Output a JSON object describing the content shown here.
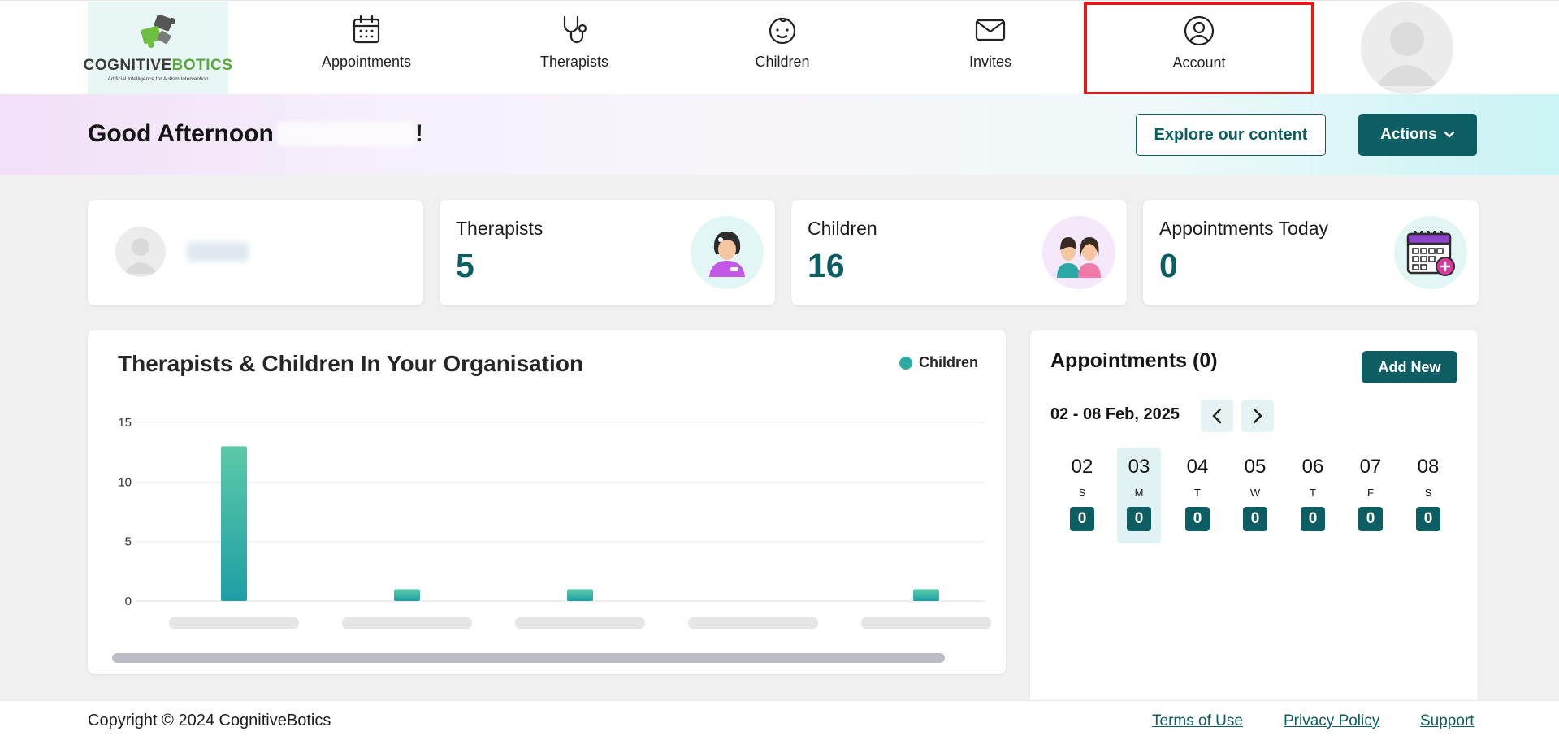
{
  "brand": {
    "name_a": "COGNITIVE",
    "name_b": "BOTICS",
    "tagline": "Artificial Intelligence for Autism Intervention"
  },
  "nav": {
    "items": [
      {
        "label": "Appointments",
        "icon": "calendar-icon"
      },
      {
        "label": "Therapists",
        "icon": "stethoscope-icon"
      },
      {
        "label": "Children",
        "icon": "baby-face-icon"
      },
      {
        "label": "Invites",
        "icon": "envelope-icon"
      },
      {
        "label": "Account",
        "icon": "user-circle-icon",
        "active": true
      }
    ]
  },
  "greeting": {
    "prefix": "Good Afternoon",
    "suffix": "!",
    "explore_label": "Explore our content",
    "actions_label": "Actions"
  },
  "stats": [
    {
      "title": "Therapists",
      "value": "5"
    },
    {
      "title": "Children",
      "value": "16"
    },
    {
      "title": "Appointments Today",
      "value": "0"
    }
  ],
  "chart_data": {
    "type": "bar",
    "title": "Therapists & Children In Your Organisation",
    "series": [
      {
        "name": "Children",
        "values": [
          13,
          1,
          1,
          0,
          1
        ]
      }
    ],
    "categories": [
      "",
      "",
      "",
      "",
      ""
    ],
    "y_ticks": [
      0,
      5,
      10,
      15
    ],
    "ylim": [
      0,
      15
    ],
    "grid": true,
    "legend": "top-right",
    "colors": {
      "bar_top": "#5ccaa8",
      "bar_bottom": "#1e9ea6"
    }
  },
  "appointments": {
    "title": "Appointments (0)",
    "add_label": "Add New",
    "week_range": "02 - 08 Feb, 2025",
    "days": [
      {
        "num": "02",
        "letter": "S",
        "count": "0"
      },
      {
        "num": "03",
        "letter": "M",
        "count": "0",
        "selected": true
      },
      {
        "num": "04",
        "letter": "T",
        "count": "0"
      },
      {
        "num": "05",
        "letter": "W",
        "count": "0"
      },
      {
        "num": "06",
        "letter": "T",
        "count": "0"
      },
      {
        "num": "07",
        "letter": "F",
        "count": "0"
      },
      {
        "num": "08",
        "letter": "S",
        "count": "0"
      }
    ]
  },
  "footer": {
    "copyright": "Copyright © 2024 CognitiveBotics",
    "links": [
      "Terms of Use",
      "Privacy Policy",
      "Support"
    ]
  },
  "colors": {
    "primary": "#0c5e63",
    "active_outline": "#e11b1b"
  }
}
